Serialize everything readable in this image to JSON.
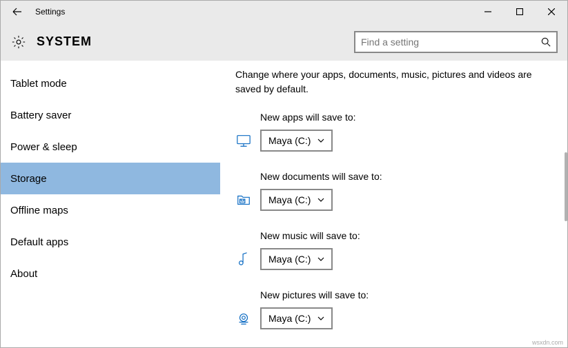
{
  "window": {
    "title": "Settings"
  },
  "header": {
    "page_title": "SYSTEM",
    "search_placeholder": "Find a setting"
  },
  "sidebar": {
    "items": [
      {
        "label": "Tablet mode"
      },
      {
        "label": "Battery saver"
      },
      {
        "label": "Power & sleep"
      },
      {
        "label": "Storage",
        "selected": true
      },
      {
        "label": "Offline maps"
      },
      {
        "label": "Default apps"
      },
      {
        "label": "About"
      }
    ]
  },
  "content": {
    "description": "Change where your apps, documents, music, pictures and videos are saved by default.",
    "settings": [
      {
        "label": "New apps will save to:",
        "value": "Maya (C:)",
        "icon": "monitor"
      },
      {
        "label": "New documents will save to:",
        "value": "Maya (C:)",
        "icon": "folder"
      },
      {
        "label": "New music will save to:",
        "value": "Maya (C:)",
        "icon": "music"
      },
      {
        "label": "New pictures will save to:",
        "value": "Maya (C:)",
        "icon": "camera"
      }
    ]
  },
  "watermark": "wsxdn.com"
}
